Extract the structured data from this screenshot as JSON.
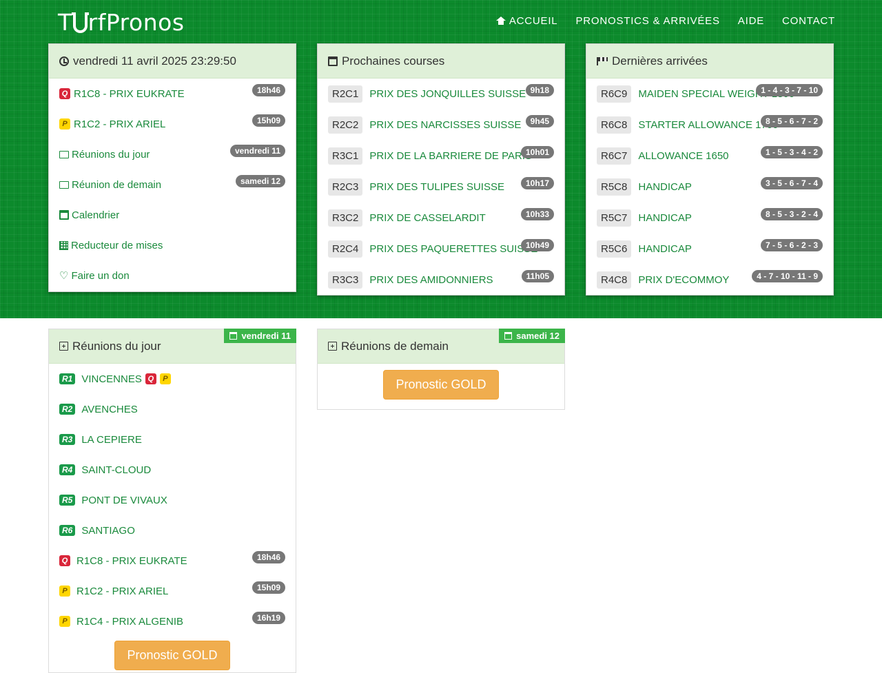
{
  "brand": {
    "pre": "T",
    "post": "rfPronos"
  },
  "nav": [
    {
      "label": "ACCUEIL",
      "icon": "home-icon"
    },
    {
      "label": "PRONOSTICS & ARRIVÉES"
    },
    {
      "label": "AIDE"
    },
    {
      "label": "CONTACT"
    }
  ],
  "clock_panel": {
    "title": "vendredi 11 avril 2025 23:29:50",
    "items": [
      {
        "tag": "Q",
        "label": "R1C8 - PRIX EUKRATE",
        "badge": "18h46"
      },
      {
        "tag": "P",
        "label": "R1C2 - PRIX ARIEL",
        "badge": "15h09"
      },
      {
        "icon": "folder-icon",
        "label": "Réunions du jour",
        "badge": "vendredi 11"
      },
      {
        "icon": "folder-icon",
        "label": "Réunion de demain",
        "badge": "samedi 12"
      },
      {
        "icon": "calendar-icon",
        "label": "Calendrier"
      },
      {
        "icon": "table-icon",
        "label": "Reducteur de mises"
      },
      {
        "icon": "heart-icon",
        "label": "Faire un don"
      }
    ]
  },
  "next_panel": {
    "title": "Prochaines courses",
    "items": [
      {
        "code": "R2C1",
        "label": "PRIX DES JONQUILLES SUISSE",
        "badge": "9h18"
      },
      {
        "code": "R2C2",
        "label": "PRIX DES NARCISSES SUISSE",
        "badge": "9h45"
      },
      {
        "code": "R3C1",
        "label": "PRIX DE LA BARRIERE DE PARIS",
        "badge": "10h01"
      },
      {
        "code": "R2C3",
        "label": "PRIX DES TULIPES SUISSE",
        "badge": "10h17"
      },
      {
        "code": "R3C2",
        "label": "PRIX DE CASSELARDIT",
        "badge": "10h33"
      },
      {
        "code": "R2C4",
        "label": "PRIX DES PAQUERETTES SUISSE",
        "badge": "10h49"
      },
      {
        "code": "R3C3",
        "label": "PRIX DES AMIDONNIERS",
        "badge": "11h05"
      }
    ]
  },
  "results_panel": {
    "title": "Dernières arrivées",
    "items": [
      {
        "code": "R6C9",
        "label": "MAIDEN SPECIAL WEIGHT 1800",
        "badge": "1 - 4 - 3 - 7 - 10"
      },
      {
        "code": "R6C8",
        "label": "STARTER ALLOWANCE 1700",
        "badge": "8 - 5 - 6 - 7 - 2"
      },
      {
        "code": "R6C7",
        "label": "ALLOWANCE 1650",
        "badge": "1 - 5 - 3 - 4 - 2"
      },
      {
        "code": "R5C8",
        "label": "HANDICAP",
        "badge": "3 - 5 - 6 - 7 - 4"
      },
      {
        "code": "R5C7",
        "label": "HANDICAP",
        "badge": "8 - 5 - 3 - 2 - 4"
      },
      {
        "code": "R5C6",
        "label": "HANDICAP",
        "badge": "7 - 5 - 6 - 2 - 3"
      },
      {
        "code": "R4C8",
        "label": "PRIX D'ECOMMOY",
        "badge": "4 - 7 - 10 - 11 - 9"
      }
    ]
  },
  "today_panel": {
    "title": "Réunions du jour",
    "date_label": "vendredi 11",
    "meetings": [
      {
        "tag": "R1",
        "label": "VINCENNES",
        "extra": [
          "Q",
          "P"
        ]
      },
      {
        "tag": "R2",
        "label": "AVENCHES"
      },
      {
        "tag": "R3",
        "label": "LA CEPIERE"
      },
      {
        "tag": "R4",
        "label": "SAINT-CLOUD"
      },
      {
        "tag": "R5",
        "label": "PONT DE VIVAUX"
      },
      {
        "tag": "R6",
        "label": "SANTIAGO"
      }
    ],
    "races": [
      {
        "tag": "Q",
        "label": "R1C8 - PRIX EUKRATE",
        "badge": "18h46"
      },
      {
        "tag": "P",
        "label": "R1C2 - PRIX ARIEL",
        "badge": "15h09"
      },
      {
        "tag": "P",
        "label": "R1C4 - PRIX ALGENIB",
        "badge": "16h19"
      }
    ],
    "button": "Pronostic GOLD"
  },
  "tomorrow_panel": {
    "title": "Réunions de demain",
    "date_label": "samedi 12",
    "button": "Pronostic GOLD"
  },
  "colors": {
    "banner": "#0c8a2c",
    "link": "#1a8a3c",
    "header_bg": "#dff0d8",
    "gold": "#f0ad4e"
  }
}
